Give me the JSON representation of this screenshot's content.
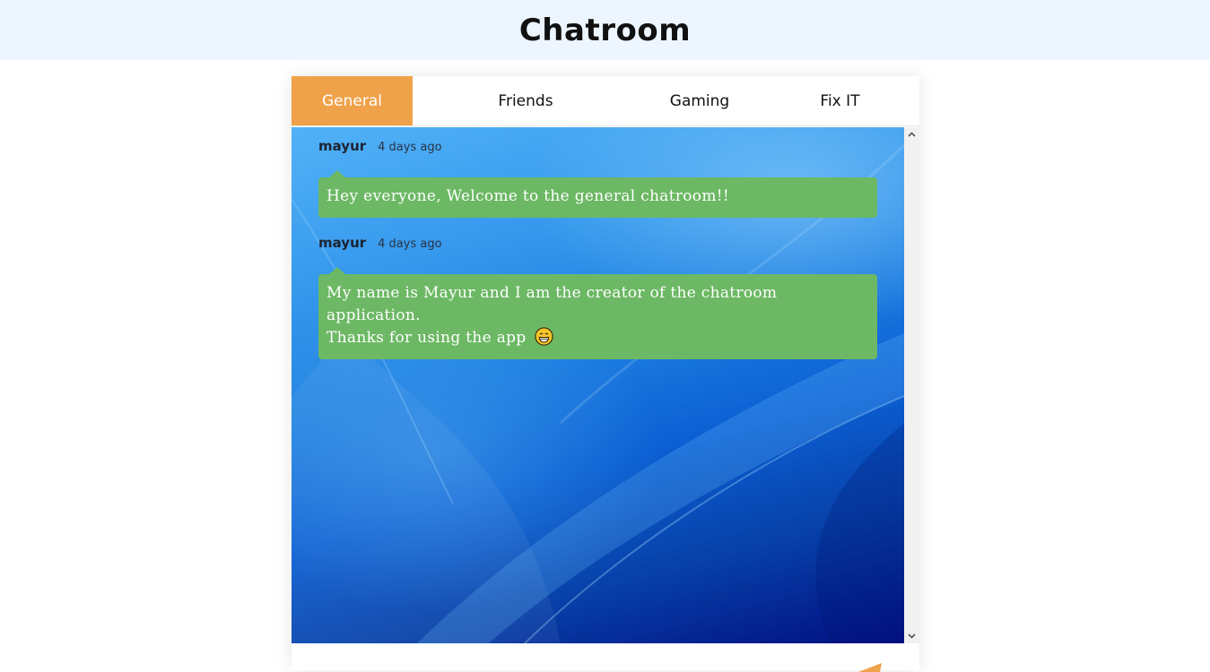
{
  "header": {
    "title": "Chatroom"
  },
  "tabs": [
    {
      "label": "General",
      "active": true
    },
    {
      "label": "Friends",
      "active": false
    },
    {
      "label": "Gaming",
      "active": false
    },
    {
      "label": "Fix IT",
      "active": false
    }
  ],
  "messages": [
    {
      "user": "mayur",
      "time": "4 days ago",
      "text_lines": [
        "Hey everyone, Welcome to the general chatroom!!"
      ]
    },
    {
      "user": "mayur",
      "time": "4 days ago",
      "text_lines": [
        "My name is Mayur and I am the creator of the chatroom application.",
        "Thanks for using the app"
      ],
      "emoji": "grinning-face-icon"
    }
  ],
  "scrollbar": {
    "up_icon": "chevron-up-icon",
    "down_icon": "chevron-down-icon"
  },
  "footer": {
    "send_icon": "send-icon"
  },
  "colors": {
    "header_bg": "#edf6fe",
    "tab_active": "#f0a24a",
    "bubble": "#6cb864",
    "chat_bg_top": "#52b2f7",
    "chat_bg_bottom": "#020f82"
  }
}
